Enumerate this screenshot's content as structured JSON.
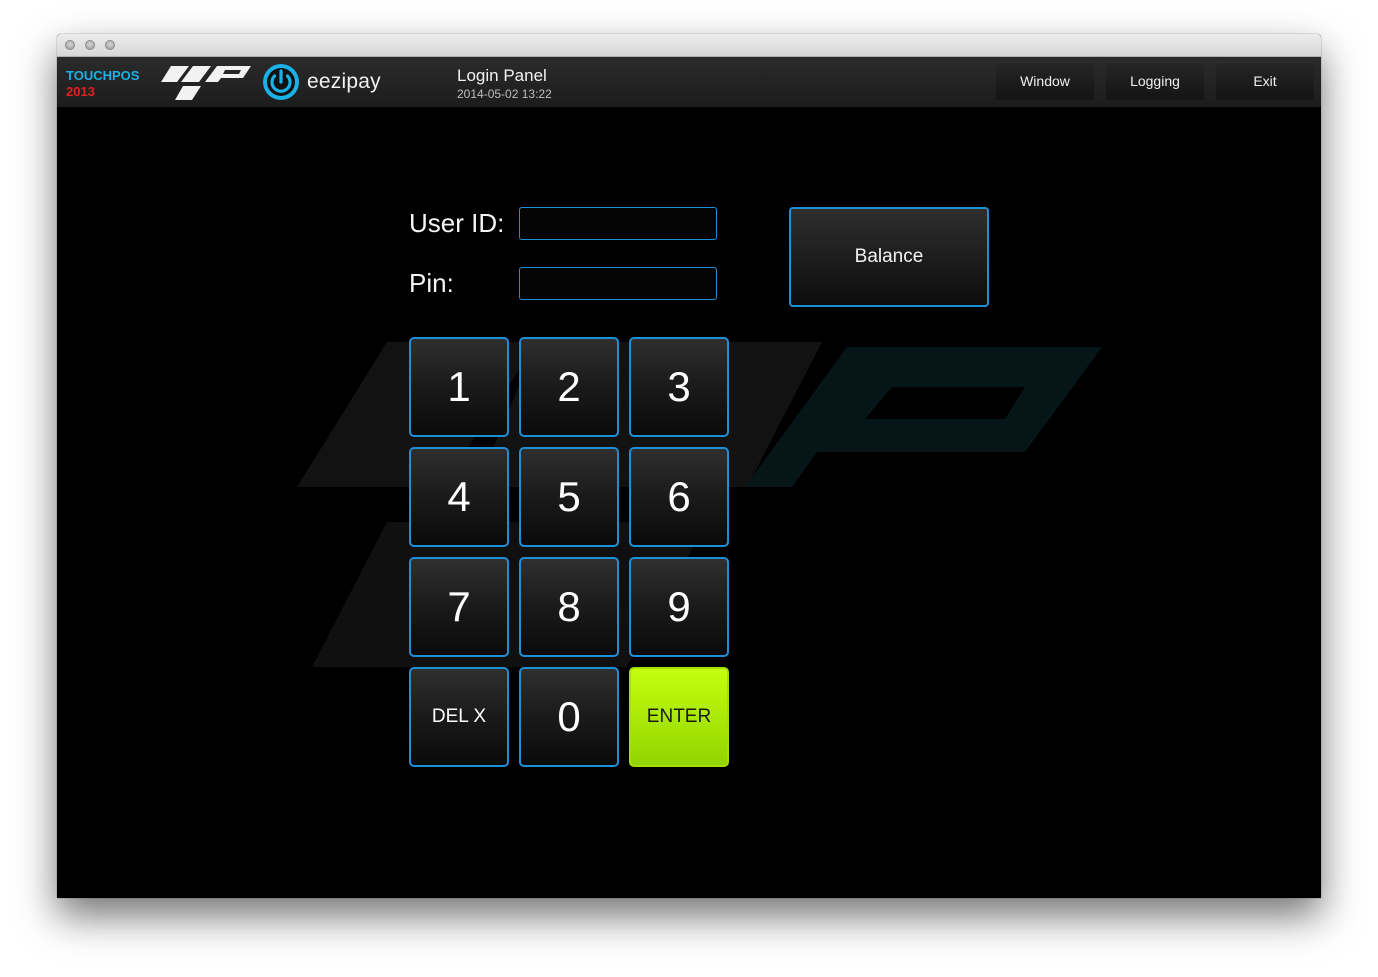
{
  "app": {
    "brand_line1": "TOUCHPOS",
    "brand_line2": "2013",
    "partner_name": "eezipay",
    "panel_title": "Login Panel",
    "panel_datetime": "2014-05-02 13:22"
  },
  "toolbar": {
    "window_label": "Window",
    "logging_label": "Logging",
    "exit_label": "Exit"
  },
  "form": {
    "user_id_label": "User ID:",
    "user_id_value": "",
    "pin_label": "Pin:",
    "pin_value": "",
    "balance_label": "Balance"
  },
  "keypad": {
    "k1": "1",
    "k2": "2",
    "k3": "3",
    "k4": "4",
    "k5": "5",
    "k6": "6",
    "k7": "7",
    "k8": "8",
    "k9": "9",
    "del": "DEL X",
    "k0": "0",
    "enter": "ENTER"
  },
  "colors": {
    "accent_blue": "#1e8fd6",
    "enter_green": "#b5f200",
    "brand_blue": "#1ab2e6",
    "brand_red": "#e02020"
  }
}
